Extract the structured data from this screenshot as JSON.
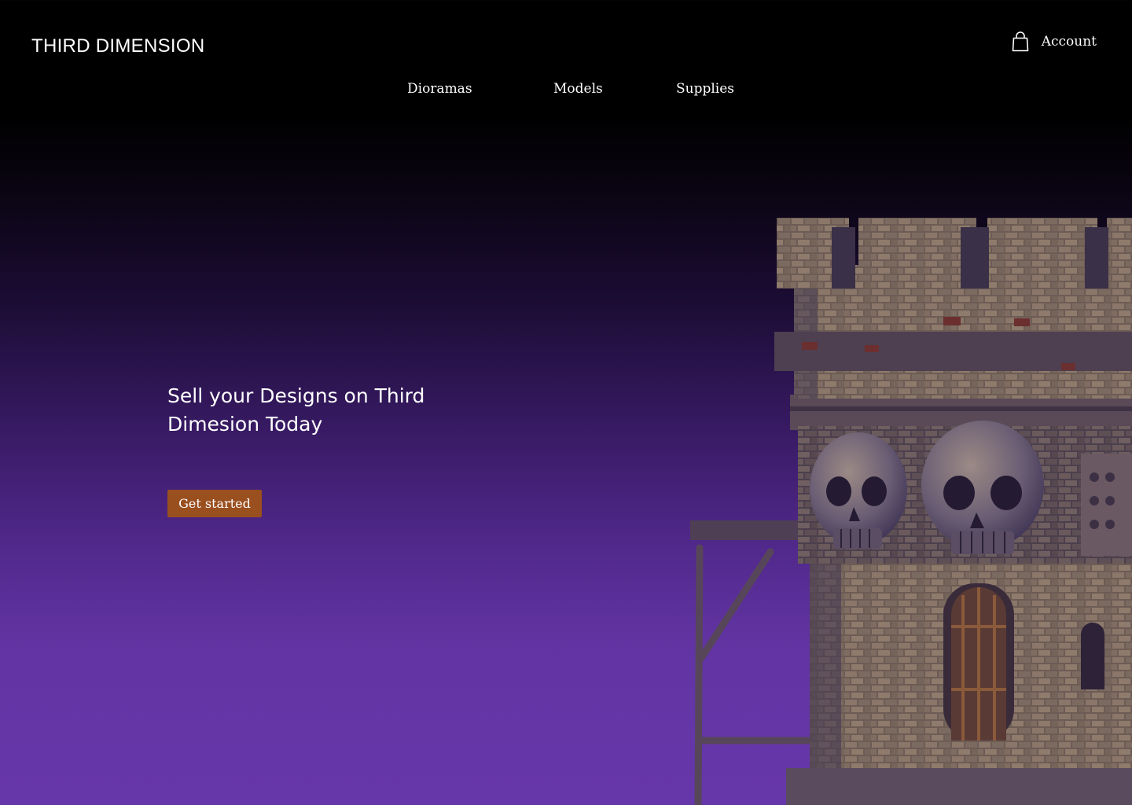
{
  "header": {
    "brand": "THIRD DIMENSION",
    "account_label": "Account",
    "account_icon": "shopping-bag-icon"
  },
  "nav": {
    "items": [
      {
        "label": "Dioramas"
      },
      {
        "label": "Models"
      },
      {
        "label": "Supplies"
      }
    ]
  },
  "hero": {
    "title": "Sell your Designs on Third Dimesion Today",
    "cta_label": "Get started",
    "image": "castle-tower-with-skulls-image"
  },
  "colors": {
    "background_top": "#000000",
    "background_bottom": "#6637a9",
    "cta_background": "#9a4f1f",
    "text": "#ffffff"
  }
}
